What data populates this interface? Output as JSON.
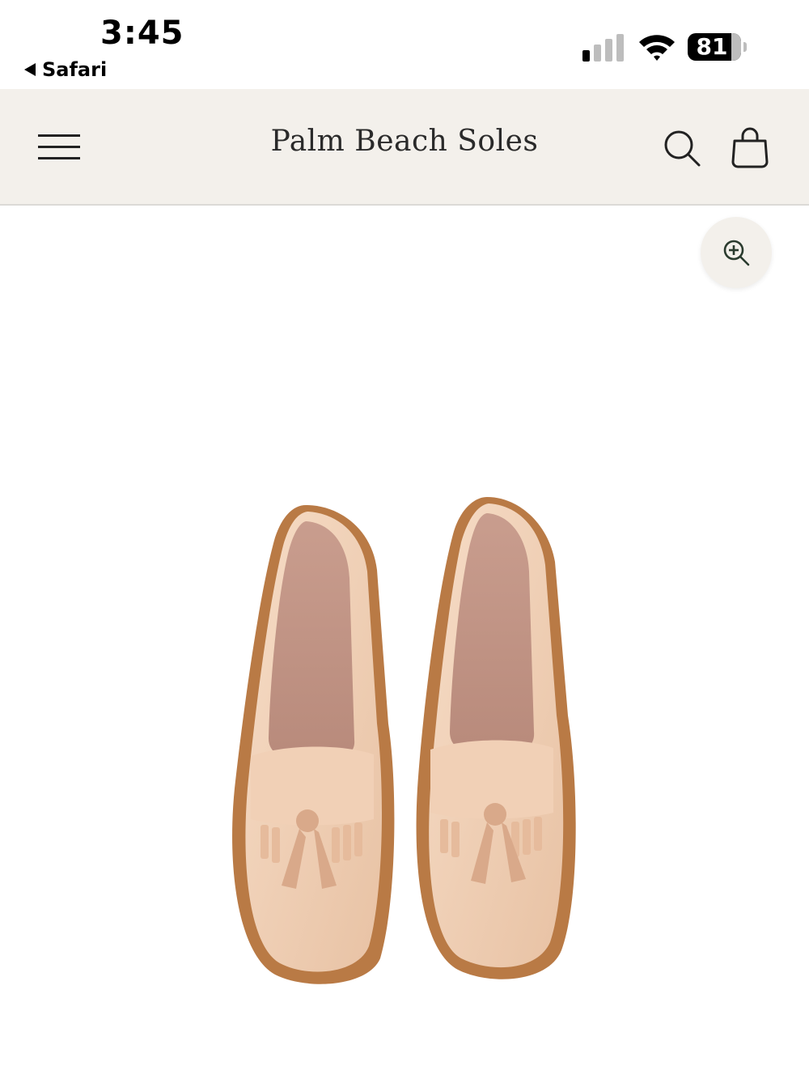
{
  "status_bar": {
    "time": "3:45",
    "back_app": "Safari",
    "battery_level": "81"
  },
  "header": {
    "site_title": "Palm Beach Soles"
  },
  "icons": {
    "menu": "hamburger-menu-icon",
    "search": "search-icon",
    "cart": "shopping-bag-icon",
    "zoom": "zoom-in-icon"
  },
  "colors": {
    "header_bg": "#f3f0eb",
    "text": "#2a2a2a",
    "shoe": "#ecc9ae",
    "sole": "#b97a45"
  }
}
